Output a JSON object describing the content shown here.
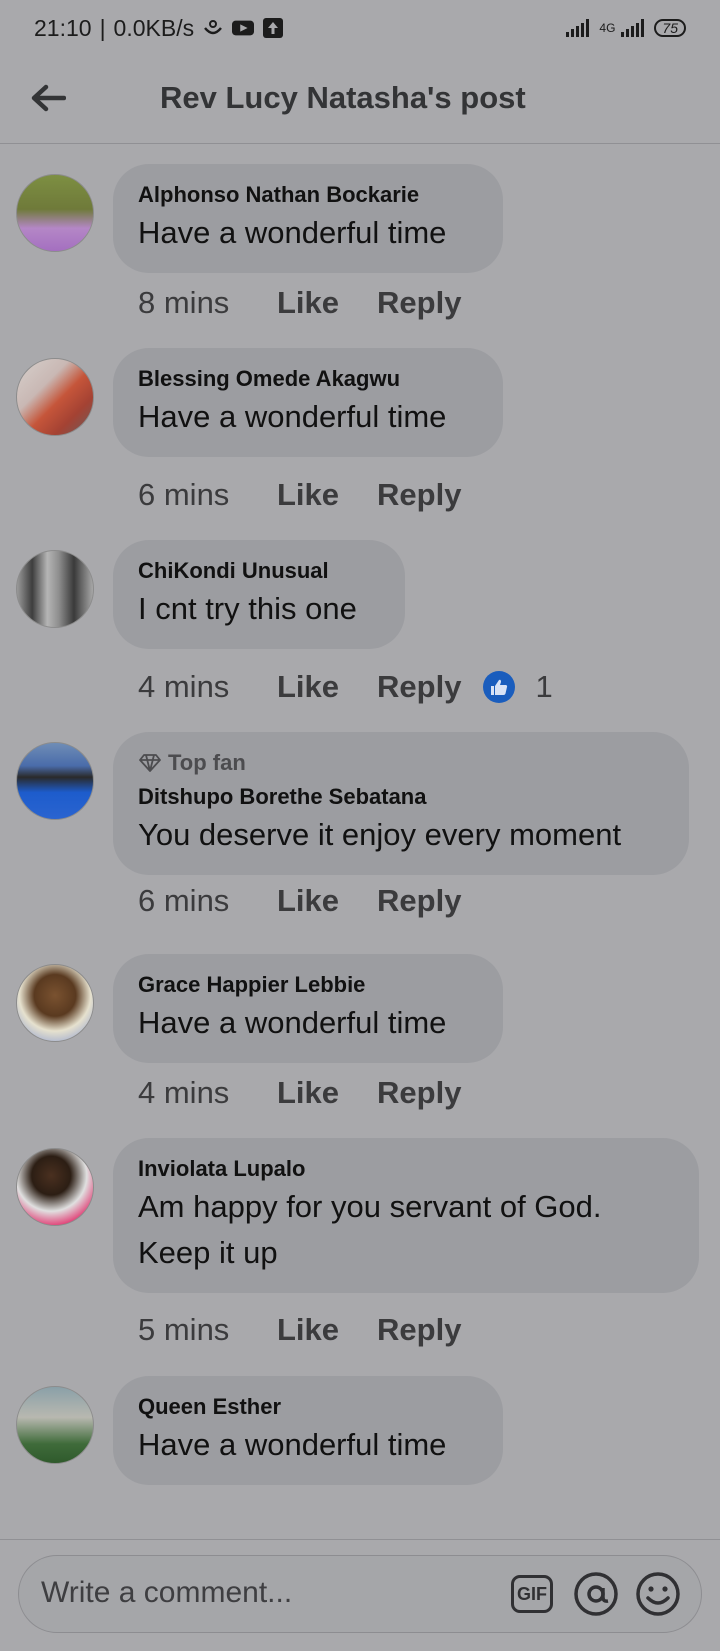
{
  "status_bar": {
    "time": "21:10",
    "speed": "0.0KB/s",
    "network": "4G",
    "battery": "75"
  },
  "header": {
    "title": "Rev Lucy Natasha's post"
  },
  "comments": [
    {
      "author": "Alphonso Nathan Bockarie",
      "text": "Have a wonderful time",
      "time": "8 mins",
      "like": "Like",
      "reply": "Reply"
    },
    {
      "author": "Blessing Omede Akagwu",
      "text": "Have a wonderful time",
      "time": "6 mins",
      "like": "Like",
      "reply": "Reply"
    },
    {
      "author": "ChiKondi Unusual",
      "text": "I cnt try this one",
      "time": "4 mins",
      "like": "Like",
      "reply": "Reply",
      "reactions": "1"
    },
    {
      "badge": "Top fan",
      "author": "Ditshupo Borethe Sebatana",
      "text": "You deserve it enjoy every moment",
      "time": "6 mins",
      "like": "Like",
      "reply": "Reply"
    },
    {
      "author": "Grace Happier Lebbie",
      "text": "Have a wonderful time",
      "time": "4 mins",
      "like": "Like",
      "reply": "Reply"
    },
    {
      "author": "Inviolata Lupalo",
      "text": "Am  happy  for  you  servant of God.",
      "text2": "Keep it up",
      "time": "5 mins",
      "like": "Like",
      "reply": "Reply"
    },
    {
      "author": "Queen Esther",
      "text": "Have a wonderful time"
    }
  ],
  "composer": {
    "placeholder": "Write a comment...",
    "gif_label": "GIF"
  },
  "colors": {
    "background": "#a9a9ac",
    "bubble": "#9c9da1",
    "like_badge": "#1a5dbd"
  },
  "icons": [
    "back-arrow-icon",
    "gif-icon",
    "mention-icon",
    "emoji-icon",
    "diamond-icon",
    "thumbs-up-icon"
  ]
}
